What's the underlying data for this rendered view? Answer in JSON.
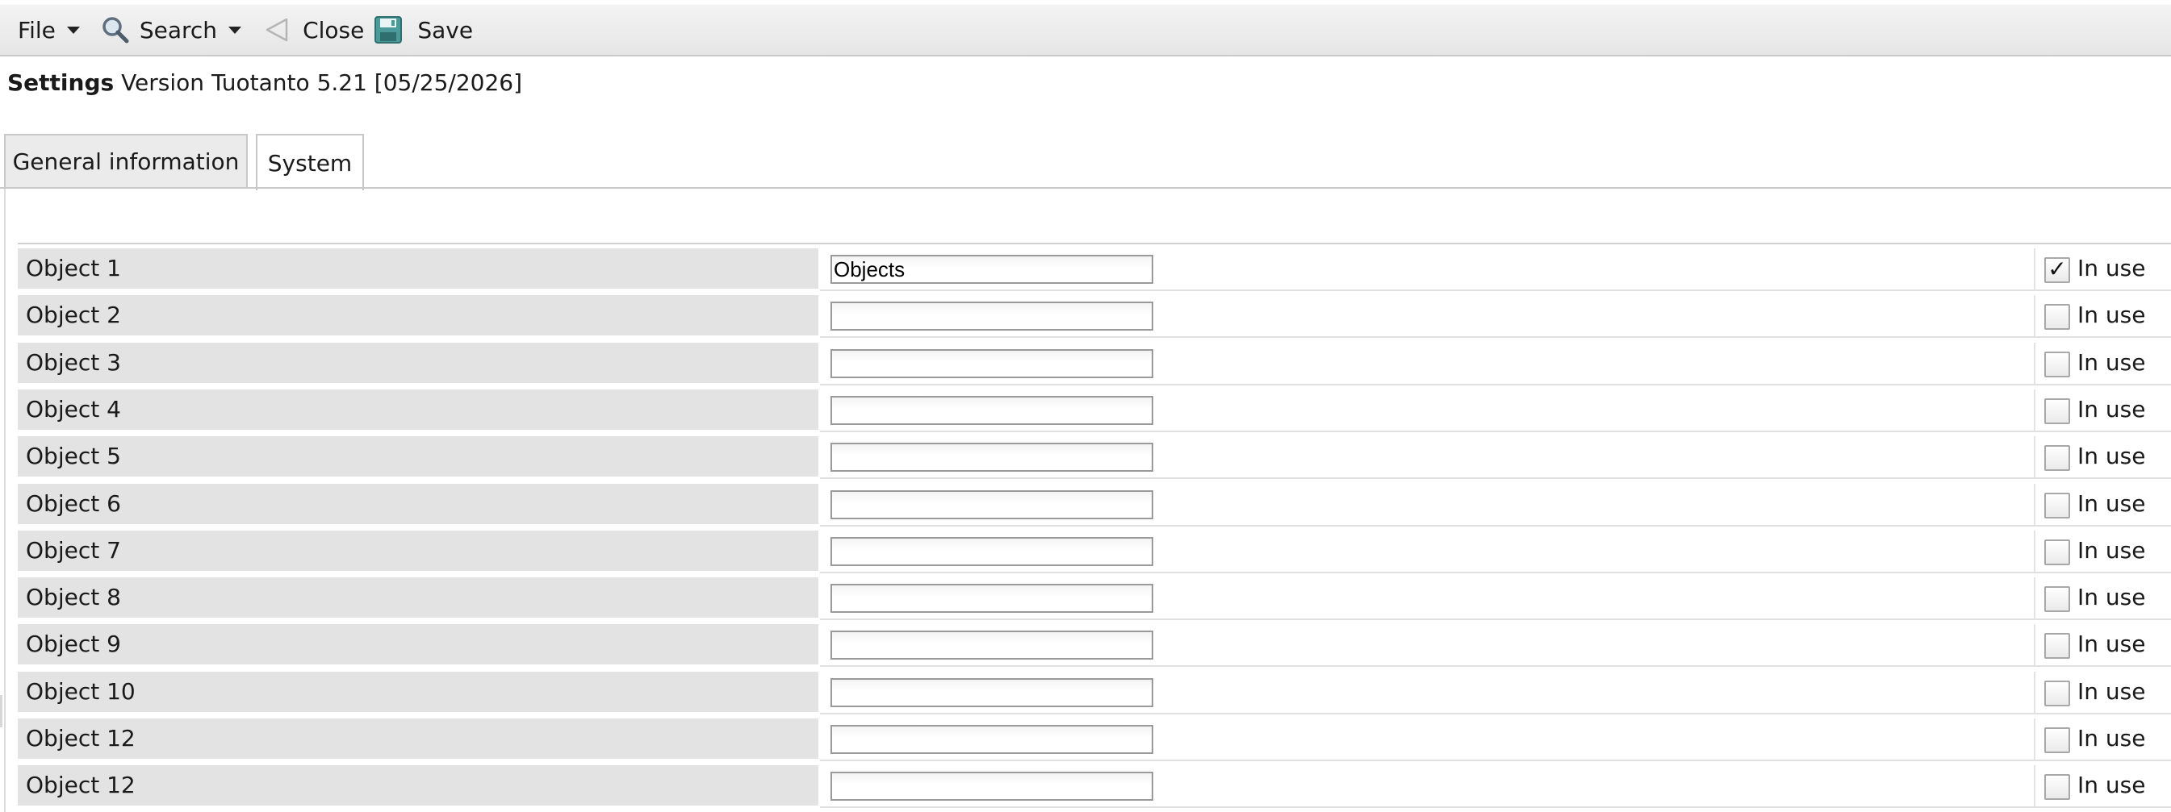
{
  "toolbar": {
    "file_label": "File",
    "search_label": "Search",
    "close_label": "Close",
    "save_label": "Save"
  },
  "header": {
    "title_bold": "Settings",
    "title_rest": "Version Tuotanto 5.21 [05/25/2026]"
  },
  "tabs": [
    {
      "label": "General information",
      "active": false
    },
    {
      "label": "System",
      "active": true
    }
  ],
  "rows": [
    {
      "label": "Object 1",
      "value": "Objects",
      "in_use": true,
      "in_use_label": "In use"
    },
    {
      "label": "Object 2",
      "value": "",
      "in_use": false,
      "in_use_label": "In use"
    },
    {
      "label": "Object 3",
      "value": "",
      "in_use": false,
      "in_use_label": "In use"
    },
    {
      "label": "Object 4",
      "value": "",
      "in_use": false,
      "in_use_label": "In use"
    },
    {
      "label": "Object 5",
      "value": "",
      "in_use": false,
      "in_use_label": "In use"
    },
    {
      "label": "Object 6",
      "value": "",
      "in_use": false,
      "in_use_label": "In use"
    },
    {
      "label": "Object 7",
      "value": "",
      "in_use": false,
      "in_use_label": "In use"
    },
    {
      "label": "Object 8",
      "value": "",
      "in_use": false,
      "in_use_label": "In use"
    },
    {
      "label": "Object 9",
      "value": "",
      "in_use": false,
      "in_use_label": "In use"
    },
    {
      "label": "Object 10",
      "value": "",
      "in_use": false,
      "in_use_label": "In use"
    },
    {
      "label": "Object 12",
      "value": "",
      "in_use": false,
      "in_use_label": "In use"
    },
    {
      "label": "Object 12",
      "value": "",
      "in_use": false,
      "in_use_label": "In use"
    }
  ],
  "icons": {
    "file_menu": "chevron-down-icon",
    "search": "magnifier-icon",
    "close": "back-arrow-icon",
    "save": "floppy-disk-icon",
    "checkbox_mark": "checkmark-icon"
  },
  "colors": {
    "toolbar_bg": "#e9e9e9",
    "row_label_bg": "#e3e3e3",
    "save_icon": "#3f8f8f",
    "search_icon": "#6f7f8f"
  }
}
